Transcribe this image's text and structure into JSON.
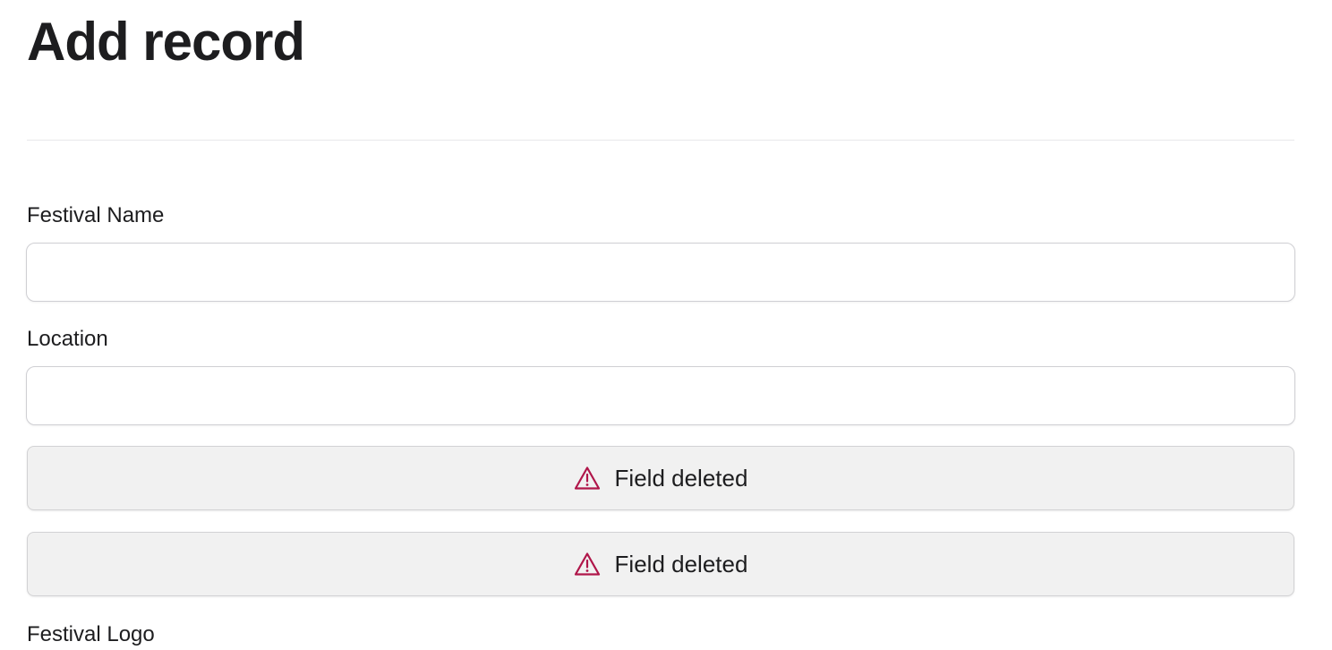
{
  "page": {
    "title": "Add record"
  },
  "form": {
    "festival_name": {
      "label": "Festival Name",
      "value": "",
      "placeholder": ""
    },
    "location": {
      "label": "Location",
      "value": "",
      "placeholder": ""
    },
    "deleted_fields": [
      {
        "text": "Field deleted",
        "icon": "warning-triangle-icon"
      },
      {
        "text": "Field deleted",
        "icon": "warning-triangle-icon"
      }
    ],
    "festival_logo": {
      "label": "Festival Logo"
    }
  },
  "colors": {
    "warning_icon": "#b0164a",
    "deleted_background": "#f1f1f1",
    "text": "#1d1d1f"
  }
}
